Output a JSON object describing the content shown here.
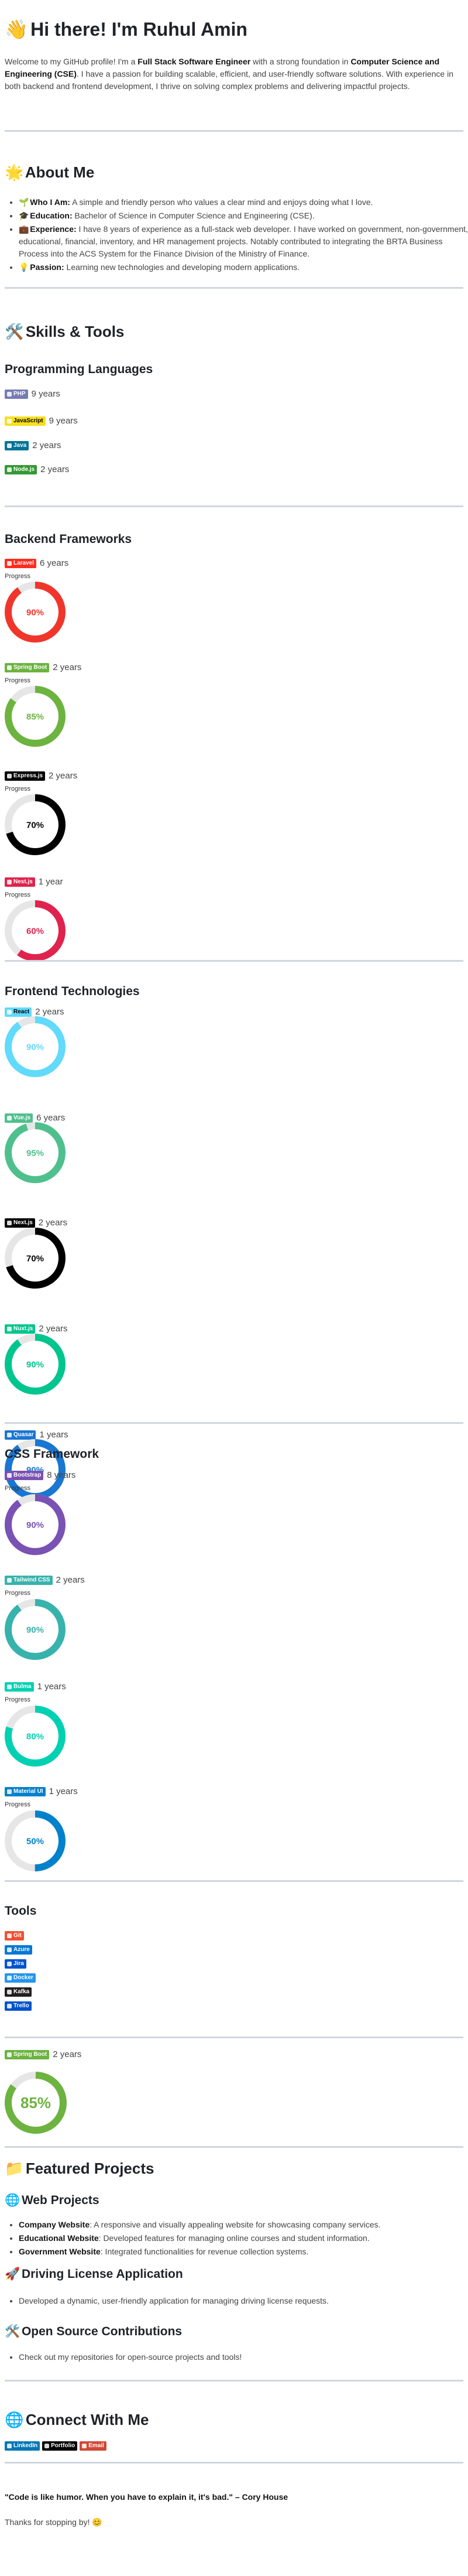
{
  "header": {
    "title": "Hi there! I'm Ruhul Amin",
    "wave_icon": "waving-hand",
    "intro": [
      {
        "t": "Welcome to my GitHub profile! I'm a "
      },
      {
        "t": "Full Stack Software Engineer",
        "b": true
      },
      {
        "t": " with a strong foundation in "
      },
      {
        "t": "Computer Science and Engineering (CSE)",
        "b": true
      },
      {
        "t": ". I have a passion for building scalable, efficient, and user-friendly software solutions. With experience in both backend and frontend development, I thrive on solving complex problems and delivering impactful projects."
      }
    ]
  },
  "about": {
    "title": "About Me",
    "items": [
      {
        "icon": "🌱",
        "label": "Who I Am:",
        "text": " A simple and friendly person who values a clear mind and enjoys doing what I love."
      },
      {
        "icon": "🎓",
        "label": "Education:",
        "text": " Bachelor of Science in Computer Science and Engineering (CSE)."
      },
      {
        "icon": "💼",
        "label": "Experience:",
        "text": " I have 8 years of experience as a full-stack web developer. I have worked on government, non-government, educational, financial, inventory, and HR management projects. Notably contributed to integrating the BRTA Business Process into the ACS System for the Finance Division of the Ministry of Finance."
      },
      {
        "icon": "💡",
        "label": "Passion:",
        "text": " Learning new technologies and developing modern applications."
      }
    ]
  },
  "skills_title": "Skills & Tools",
  "progress_label": "Progress",
  "languages": {
    "title": "Programming Languages",
    "items": [
      {
        "badge": "PHP",
        "color": "#777bb4",
        "years": "9 years"
      },
      {
        "badge": "JavaScript",
        "color": "#f7df1e",
        "text_color": "#000000",
        "years": "9 years"
      },
      {
        "badge": "Java",
        "color": "#007396",
        "years": "2 years"
      },
      {
        "badge": "Node.js",
        "color": "#339933",
        "years": "2 years"
      }
    ]
  },
  "backend": {
    "title": "Backend Frameworks",
    "items": [
      {
        "badge": "Laravel",
        "color": "#ff2d20",
        "years": "6 years",
        "percent": 90,
        "ring": "#f0362b",
        "label": "90%"
      },
      {
        "badge": "Spring Boot",
        "color": "#6db33f",
        "years": "2 years",
        "percent": 85,
        "ring": "#6db33f",
        "label": "85%"
      },
      {
        "badge": "Express.js",
        "color": "#000000",
        "years": "2 years",
        "percent": 70,
        "ring": "#000000",
        "label": "70%"
      },
      {
        "badge": "Nest.js",
        "color": "#e0234e",
        "years": "1 year",
        "percent": 60,
        "ring": "#e0234e",
        "label": "60%"
      }
    ]
  },
  "frontend": {
    "title": "Frontend Technologies",
    "items": [
      {
        "badge": "React",
        "color": "#61dafb",
        "text_color": "#000000",
        "years": "2 years",
        "percent": 90,
        "ring": "#61dafb",
        "label": "90%"
      },
      {
        "badge": "Vue.js",
        "color": "#4fc08d",
        "years": "6 years",
        "percent": 95,
        "ring": "#4fc08d",
        "label": "95%"
      },
      {
        "badge": "Next.js",
        "color": "#000000",
        "years": "2 years",
        "percent": 70,
        "ring": "#000000",
        "label": "70%"
      },
      {
        "badge": "Nuxt.js",
        "color": "#00c58e",
        "years": "2 years",
        "percent": 90,
        "ring": "#00c58e",
        "label": "90%"
      },
      {
        "badge": "Quasar",
        "color": "#1976d2",
        "years": "1 years",
        "percent": 90,
        "ring": "#1976d2",
        "label": "90%"
      }
    ]
  },
  "css": {
    "title": "CSS Framework",
    "items": [
      {
        "badge": "Bootstrap",
        "color": "#7952b3",
        "years": "8 years",
        "percent": 90,
        "ring": "#7952b3",
        "label": "90%"
      },
      {
        "badge": "Tailwind CSS",
        "color": "#38b2ac",
        "years": "2 years",
        "percent": 90,
        "ring": "#38b2ac",
        "label": "90%"
      },
      {
        "badge": "Bulma",
        "color": "#00d1b2",
        "years": "1 years",
        "percent": 80,
        "ring": "#00d1b2",
        "label": "80%"
      },
      {
        "badge": "Material UI",
        "color": "#0081cb",
        "years": "1 years",
        "percent": 50,
        "ring": "#0081cb",
        "label": "50%"
      }
    ]
  },
  "tools": {
    "title": "Tools",
    "items": [
      {
        "badge": "Git",
        "color": "#f05032"
      },
      {
        "badge": "Azure",
        "color": "#0078d4"
      },
      {
        "badge": "Jira",
        "color": "#0052cc"
      },
      {
        "badge": "Docker",
        "color": "#2496ed"
      },
      {
        "badge": "Kafka",
        "color": "#231f20"
      },
      {
        "badge": "Trello",
        "color": "#0052cc"
      }
    ]
  },
  "extra": {
    "badge": "Spring Boot",
    "color": "#6db33f",
    "years": "2 years",
    "percent": 85,
    "ring": "#6db33f",
    "label": "85%"
  },
  "projects": {
    "title": "Featured Projects",
    "web_title": "Web Projects",
    "web_items": [
      {
        "label": "Company Website",
        "text": ": A responsive and visually appealing website for showcasing company services."
      },
      {
        "label": "Educational Website",
        "text": ": Developed features for managing online courses and student information."
      },
      {
        "label": "Government Website",
        "text": ": Integrated functionalities for revenue collection systems."
      }
    ],
    "driving_title": "Driving License Application",
    "driving_items": [
      "Developed a dynamic, user-friendly application for managing driving license requests."
    ],
    "oss_title": "Open Source Contributions",
    "oss_items": [
      "Check out my repositories for open-source projects and tools!"
    ]
  },
  "connect": {
    "title": "Connect With Me",
    "items": [
      {
        "badge": "LinkedIn",
        "color": "#0077b5"
      },
      {
        "badge": "Portfolio",
        "color": "#000000"
      },
      {
        "badge": "Email",
        "color": "#d14836"
      }
    ]
  },
  "quote": "\"Code is like humor. When you have to explain it, it's bad.\" – Cory House",
  "thanks": "Thanks for stopping by! 😊"
}
